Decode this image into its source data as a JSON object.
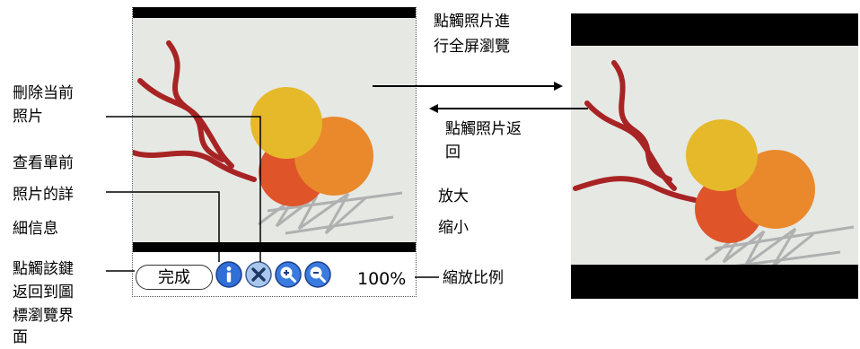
{
  "annotations": {
    "delete_line1": "刪除当前",
    "delete_line2": "照片",
    "info_line1": "查看單前",
    "info_line2": "照片的詳",
    "info_line3": "細信息",
    "done_line1": "點觸該鍵",
    "done_line2": "返回到圖",
    "done_line3": "標瀏覽界",
    "done_line4": "面",
    "tap_full_line1": "點觸照片進",
    "tap_full_line2": "行全屏瀏覽",
    "tap_back_line1": "點觸照片返",
    "tap_back_line2": "回",
    "zoom_in": "放大",
    "zoom_out": "缩小",
    "zoom_ratio": "縮放比例"
  },
  "toolbar": {
    "done_label": "完成",
    "info_icon": "info-icon",
    "delete_icon": "delete-x-icon",
    "zoom_in_icon": "zoom-in-icon",
    "zoom_out_icon": "zoom-out-icon",
    "zoom_level": "100%"
  },
  "colors": {
    "bars": "#000000",
    "photo_bg": "#e6e8e4",
    "circle_yellow": "#e6b92a",
    "circle_orange": "#e9892c",
    "circle_red": "#e0542a",
    "strokes": "#a82424",
    "icon_blue": "#2f6fd6"
  }
}
